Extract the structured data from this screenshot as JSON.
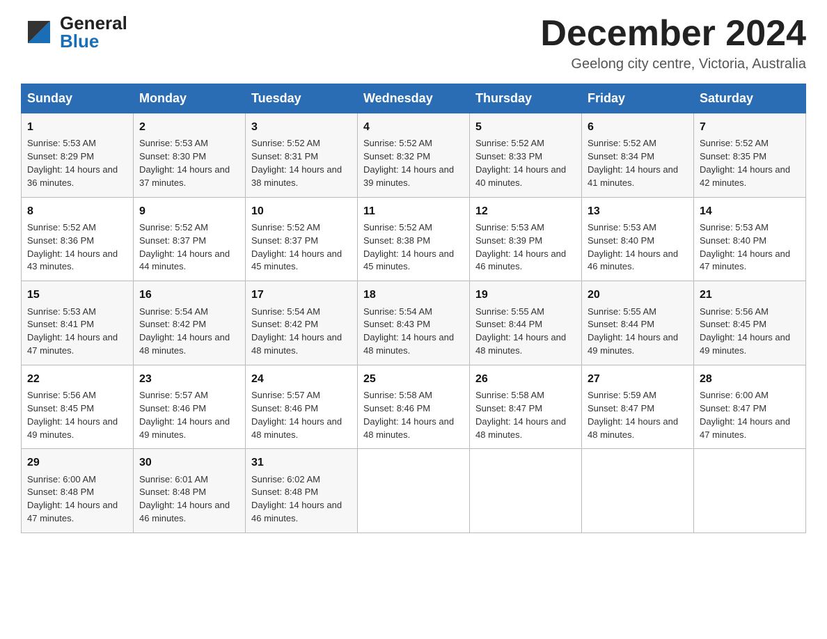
{
  "header": {
    "month_title": "December 2024",
    "location": "Geelong city centre, Victoria, Australia",
    "logo_general": "General",
    "logo_blue": "Blue"
  },
  "weekdays": [
    "Sunday",
    "Monday",
    "Tuesday",
    "Wednesday",
    "Thursday",
    "Friday",
    "Saturday"
  ],
  "weeks": [
    [
      {
        "day": "1",
        "sunrise": "5:53 AM",
        "sunset": "8:29 PM",
        "daylight": "14 hours and 36 minutes."
      },
      {
        "day": "2",
        "sunrise": "5:53 AM",
        "sunset": "8:30 PM",
        "daylight": "14 hours and 37 minutes."
      },
      {
        "day": "3",
        "sunrise": "5:52 AM",
        "sunset": "8:31 PM",
        "daylight": "14 hours and 38 minutes."
      },
      {
        "day": "4",
        "sunrise": "5:52 AM",
        "sunset": "8:32 PM",
        "daylight": "14 hours and 39 minutes."
      },
      {
        "day": "5",
        "sunrise": "5:52 AM",
        "sunset": "8:33 PM",
        "daylight": "14 hours and 40 minutes."
      },
      {
        "day": "6",
        "sunrise": "5:52 AM",
        "sunset": "8:34 PM",
        "daylight": "14 hours and 41 minutes."
      },
      {
        "day": "7",
        "sunrise": "5:52 AM",
        "sunset": "8:35 PM",
        "daylight": "14 hours and 42 minutes."
      }
    ],
    [
      {
        "day": "8",
        "sunrise": "5:52 AM",
        "sunset": "8:36 PM",
        "daylight": "14 hours and 43 minutes."
      },
      {
        "day": "9",
        "sunrise": "5:52 AM",
        "sunset": "8:37 PM",
        "daylight": "14 hours and 44 minutes."
      },
      {
        "day": "10",
        "sunrise": "5:52 AM",
        "sunset": "8:37 PM",
        "daylight": "14 hours and 45 minutes."
      },
      {
        "day": "11",
        "sunrise": "5:52 AM",
        "sunset": "8:38 PM",
        "daylight": "14 hours and 45 minutes."
      },
      {
        "day": "12",
        "sunrise": "5:53 AM",
        "sunset": "8:39 PM",
        "daylight": "14 hours and 46 minutes."
      },
      {
        "day": "13",
        "sunrise": "5:53 AM",
        "sunset": "8:40 PM",
        "daylight": "14 hours and 46 minutes."
      },
      {
        "day": "14",
        "sunrise": "5:53 AM",
        "sunset": "8:40 PM",
        "daylight": "14 hours and 47 minutes."
      }
    ],
    [
      {
        "day": "15",
        "sunrise": "5:53 AM",
        "sunset": "8:41 PM",
        "daylight": "14 hours and 47 minutes."
      },
      {
        "day": "16",
        "sunrise": "5:54 AM",
        "sunset": "8:42 PM",
        "daylight": "14 hours and 48 minutes."
      },
      {
        "day": "17",
        "sunrise": "5:54 AM",
        "sunset": "8:42 PM",
        "daylight": "14 hours and 48 minutes."
      },
      {
        "day": "18",
        "sunrise": "5:54 AM",
        "sunset": "8:43 PM",
        "daylight": "14 hours and 48 minutes."
      },
      {
        "day": "19",
        "sunrise": "5:55 AM",
        "sunset": "8:44 PM",
        "daylight": "14 hours and 48 minutes."
      },
      {
        "day": "20",
        "sunrise": "5:55 AM",
        "sunset": "8:44 PM",
        "daylight": "14 hours and 49 minutes."
      },
      {
        "day": "21",
        "sunrise": "5:56 AM",
        "sunset": "8:45 PM",
        "daylight": "14 hours and 49 minutes."
      }
    ],
    [
      {
        "day": "22",
        "sunrise": "5:56 AM",
        "sunset": "8:45 PM",
        "daylight": "14 hours and 49 minutes."
      },
      {
        "day": "23",
        "sunrise": "5:57 AM",
        "sunset": "8:46 PM",
        "daylight": "14 hours and 49 minutes."
      },
      {
        "day": "24",
        "sunrise": "5:57 AM",
        "sunset": "8:46 PM",
        "daylight": "14 hours and 48 minutes."
      },
      {
        "day": "25",
        "sunrise": "5:58 AM",
        "sunset": "8:46 PM",
        "daylight": "14 hours and 48 minutes."
      },
      {
        "day": "26",
        "sunrise": "5:58 AM",
        "sunset": "8:47 PM",
        "daylight": "14 hours and 48 minutes."
      },
      {
        "day": "27",
        "sunrise": "5:59 AM",
        "sunset": "8:47 PM",
        "daylight": "14 hours and 48 minutes."
      },
      {
        "day": "28",
        "sunrise": "6:00 AM",
        "sunset": "8:47 PM",
        "daylight": "14 hours and 47 minutes."
      }
    ],
    [
      {
        "day": "29",
        "sunrise": "6:00 AM",
        "sunset": "8:48 PM",
        "daylight": "14 hours and 47 minutes."
      },
      {
        "day": "30",
        "sunrise": "6:01 AM",
        "sunset": "8:48 PM",
        "daylight": "14 hours and 46 minutes."
      },
      {
        "day": "31",
        "sunrise": "6:02 AM",
        "sunset": "8:48 PM",
        "daylight": "14 hours and 46 minutes."
      },
      null,
      null,
      null,
      null
    ]
  ]
}
